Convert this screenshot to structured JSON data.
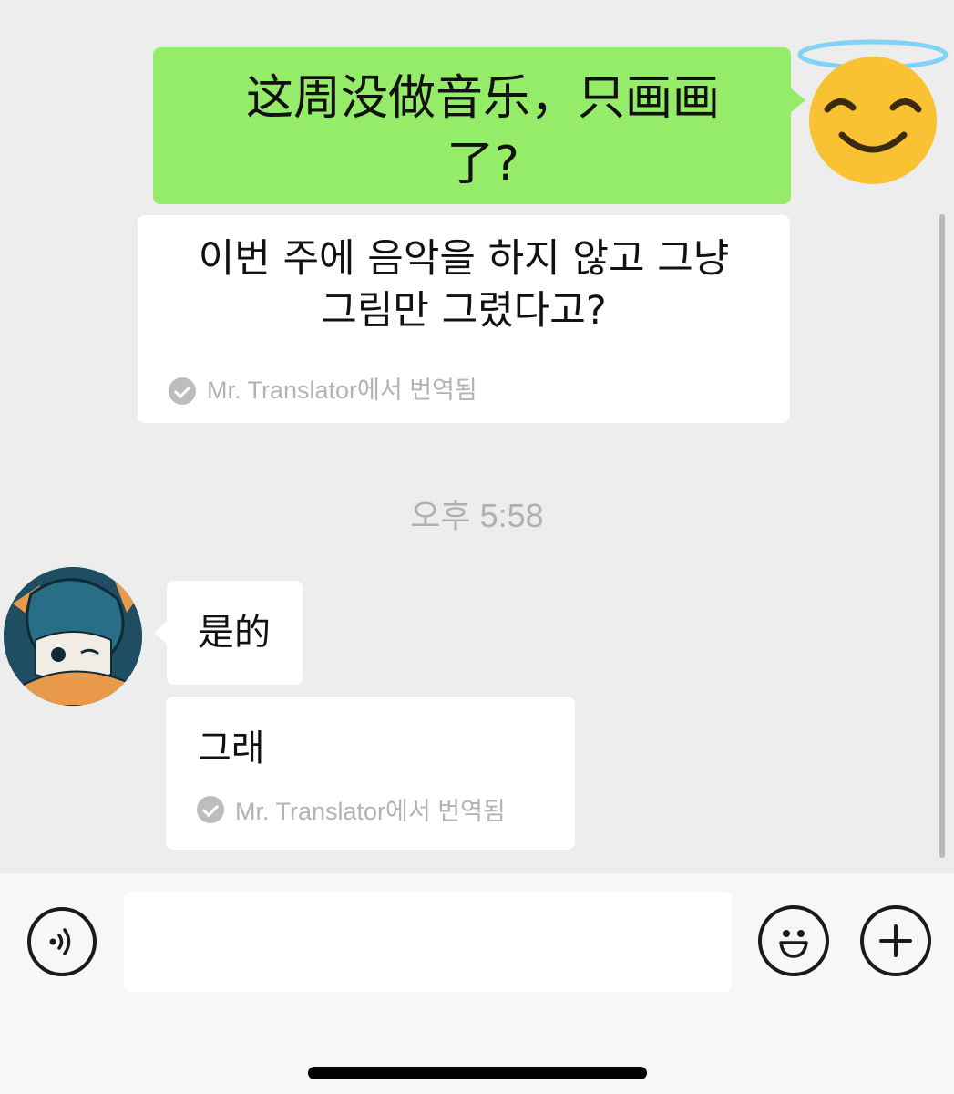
{
  "messages": {
    "sent_text": "这周没做音乐，只画画了?",
    "sent_translation": "이번 주에 음악을 하지 않고 그냥 그림만 그렸다고?",
    "translation_note": "Mr. Translator에서 번역됨",
    "timestamp": "오후 5:58",
    "received_text": "是的",
    "received_translation": "그래"
  },
  "input": {
    "placeholder": ""
  },
  "icons": {
    "sent_avatar": "smiling-face-with-halo-icon",
    "received_avatar": "drawn-character-avatar",
    "voice": "voice-icon",
    "emoji": "emoji-icon",
    "plus": "plus-icon",
    "translated": "check-circle-icon"
  },
  "colors": {
    "sent_bubble": "#95ec69",
    "received_bubble": "#ffffff",
    "background": "#ededed",
    "timestamp": "#b0b0b0"
  }
}
